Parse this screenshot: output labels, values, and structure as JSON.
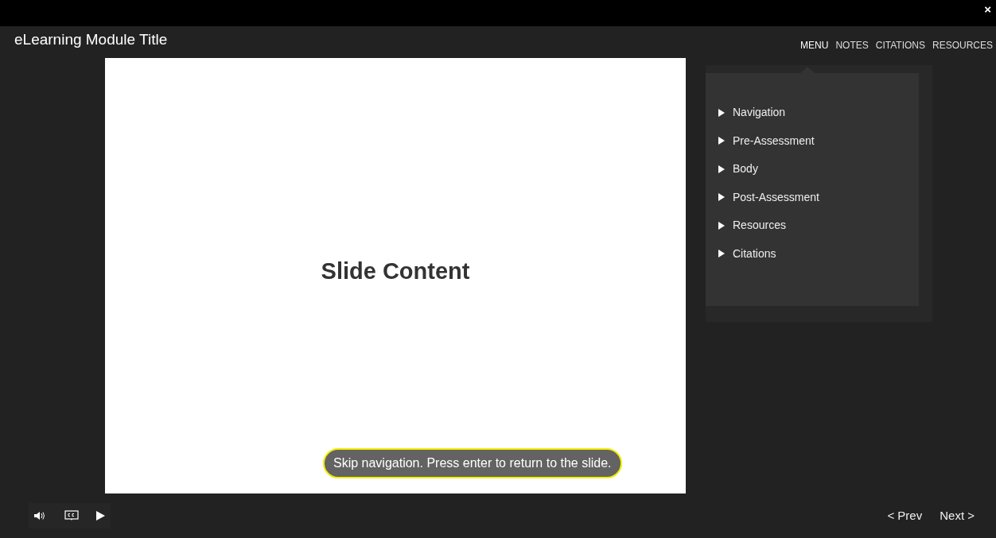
{
  "close_button": "×",
  "title": "eLearning Module Title",
  "tabs": [
    {
      "label": "MENU",
      "selected": true
    },
    {
      "label": "NOTES",
      "selected": false
    },
    {
      "label": "CITATIONS",
      "selected": false
    },
    {
      "label": "RESOURCES",
      "selected": false
    }
  ],
  "menu": {
    "items": [
      "Navigation",
      "Pre-Assessment",
      "Body",
      "Post-Assessment",
      "Resources",
      "Citations"
    ]
  },
  "slide": {
    "heading": "Slide Content",
    "skip_notice": "Skip navigation. Press enter to return to the slide."
  },
  "nav": {
    "prev": "< Prev",
    "next": "Next >"
  }
}
